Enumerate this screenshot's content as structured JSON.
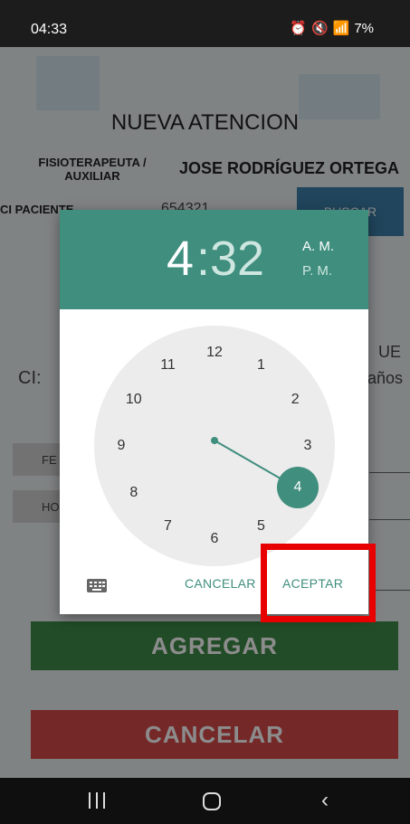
{
  "status_bar": {
    "time": "04:33",
    "icons": [
      "alarm-icon",
      "mute-icon",
      "wifi-icon",
      "signal-icon"
    ],
    "battery": "7%"
  },
  "app": {
    "title": "NUEVA ATENCION",
    "fisio_label": "FISIOTERAPEUTA / AUXILIAR",
    "fisio_name": "JOSE RODRÍGUEZ ORTEGA",
    "ci_label": "CI PACIENTE",
    "ci_value": "654321",
    "buscar_label": "BUSCAR",
    "partial_ci": "CI:",
    "partial_ue": "UE",
    "partial_anos": "años",
    "fecha_stub": "FE",
    "hora_stub": "HO",
    "agregar_label": "AGREGAR",
    "cancelar_label": "CANCELAR",
    "colors": {
      "agregar": "#3f8a48",
      "cancelar": "#d64a4a",
      "buscar": "#3b7fa8"
    }
  },
  "time_picker": {
    "hour": "4",
    "colon": ":",
    "minute": "32",
    "am": "A. M.",
    "pm": "P. M.",
    "selected_period": "A. M.",
    "numbers": [
      "12",
      "1",
      "2",
      "3",
      "4",
      "5",
      "6",
      "7",
      "8",
      "9",
      "10",
      "11"
    ],
    "selected_number": "4",
    "cancel_label": "CANCELAR",
    "accept_label": "ACEPTAR",
    "accent_color": "#3f8e7e"
  },
  "highlight": {
    "target": "accept-button",
    "color": "#e80000"
  },
  "nav_bar": {
    "icons": [
      "recent-apps-icon",
      "home-icon",
      "back-icon"
    ]
  }
}
